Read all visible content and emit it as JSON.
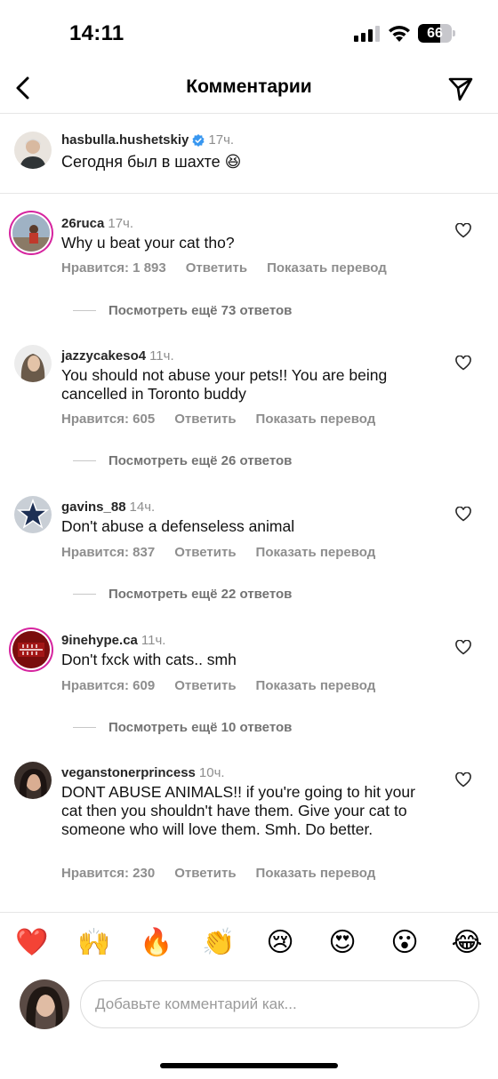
{
  "status_bar": {
    "time": "14:11",
    "battery_percent": 66,
    "battery_label": "66"
  },
  "header": {
    "title": "Комментарии"
  },
  "caption": {
    "username": "hasbulla.hushetskiy",
    "time": "17ч.",
    "text": "Сегодня был в шахте 😆"
  },
  "comments": [
    {
      "username": "26ruca",
      "time": "17ч.",
      "text": "Why u beat your cat tho?",
      "likes": "Нравится: 1 893",
      "reply": "Ответить",
      "translate": "Показать перевод",
      "more_replies": "Посмотреть ещё 73 ответов"
    },
    {
      "username": "jazzycakeso4",
      "time": "11ч.",
      "text": "You should not abuse your pets!! You are being cancelled in Toronto buddy",
      "likes": "Нравится: 605",
      "reply": "Ответить",
      "translate": "Показать перевод",
      "more_replies": "Посмотреть ещё 26 ответов"
    },
    {
      "username": "gavins_88",
      "time": "14ч.",
      "text": "Don't abuse a defenseless animal",
      "likes": "Нравится: 837",
      "reply": "Ответить",
      "translate": "Показать перевод",
      "more_replies": "Посмотреть ещё 22 ответов"
    },
    {
      "username": "9inehype.ca",
      "time": "11ч.",
      "text": "Don't fxck with cats.. smh",
      "likes": "Нравится: 609",
      "reply": "Ответить",
      "translate": "Показать перевод",
      "more_replies": "Посмотреть ещё 10 ответов"
    },
    {
      "username": "veganstonerprincess",
      "time": "10ч.",
      "text": "DONT ABUSE ANIMALS!! if you're going to hit your cat then you shouldn't have them. Give your cat to someone who will love them. Smh. Do better.",
      "likes": "Нравится: 230",
      "reply": "Ответить",
      "translate": "Показать перевод"
    }
  ],
  "reactions": [
    "❤️",
    "🙌",
    "🔥",
    "👏",
    "😢",
    "😍",
    "😮",
    "😂"
  ],
  "composer": {
    "placeholder": "Добавьте комментарий как..."
  },
  "colors": {
    "verified": "#3897f0",
    "secondary_text": "#8e8e8e",
    "divider": "#e6e6e6"
  },
  "icons": [
    "back-chevron-icon",
    "send-icon",
    "verified-badge-icon",
    "heart-outline-icon",
    "signal-icon",
    "wifi-icon",
    "battery-icon"
  ]
}
